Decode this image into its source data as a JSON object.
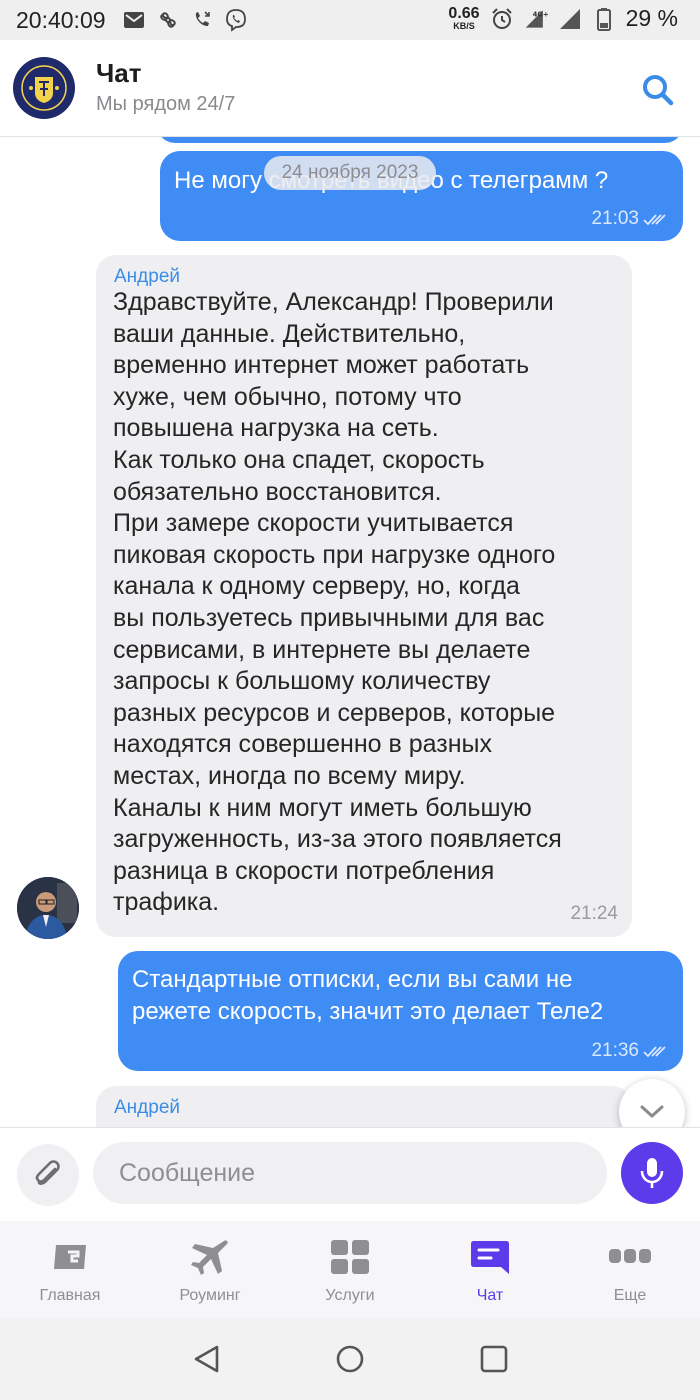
{
  "status_bar": {
    "time": "20:40:09",
    "speed_value": "0.66",
    "speed_unit": "KB/S",
    "network": "4G+",
    "battery": "29 %"
  },
  "header": {
    "title": "Чат",
    "subtitle": "Мы рядом 24/7"
  },
  "chat": {
    "date_chip": "24 ноября 2023",
    "messages": [
      {
        "direction": "outgoing",
        "text": "Не могу смотреть видео с телеграмм ?",
        "time": "21:03",
        "status": "read"
      },
      {
        "direction": "incoming",
        "sender": "Андрей",
        "text": "Здравствуйте, Александр! Проверили\nваши данные. Действительно,\nвременно интернет может работать\nхуже, чем обычно, потому что\nповышена нагрузка на сеть.\nКак только она спадет, скорость\nобязательно восстановится.\nПри замере скорости учитывается\nпиковая скорость при нагрузке одного\nканала к одному серверу, но, когда\nвы пользуетесь привычными для вас\nсервисами, в интернете вы делаете\nзапросы к большому количеству\nразных ресурсов и серверов, которые\nнаходятся совершенно в разных\nместах, иногда по всему миру.\nКаналы к ним могут иметь большую\nзагруженность, из-за этого появляется\nразница в скорости потребления\nтрафика.",
        "time": "21:24"
      },
      {
        "direction": "outgoing",
        "text": "Стандартные отписки, если вы сами не\nрежете скорость, значит это делает Теле2",
        "time": "21:36",
        "status": "read"
      },
      {
        "direction": "incoming",
        "sender": "Андрей",
        "text": "",
        "time": ""
      }
    ]
  },
  "composer": {
    "placeholder": "Сообщение"
  },
  "tabs": [
    {
      "label": "Главная",
      "icon": "home-card-icon",
      "active": false
    },
    {
      "label": "Роуминг",
      "icon": "airplane-icon",
      "active": false
    },
    {
      "label": "Услуги",
      "icon": "grid-icon",
      "active": false
    },
    {
      "label": "Чат",
      "icon": "chat-icon",
      "active": true
    },
    {
      "label": "Еще",
      "icon": "more-icon",
      "active": false
    }
  ],
  "colors": {
    "outgoing_bubble": "#3f8cf5",
    "incoming_bubble": "#efeff2",
    "accent": "#5b3bea",
    "sender_name": "#3b8ce8",
    "search_icon": "#3b8ce8"
  }
}
